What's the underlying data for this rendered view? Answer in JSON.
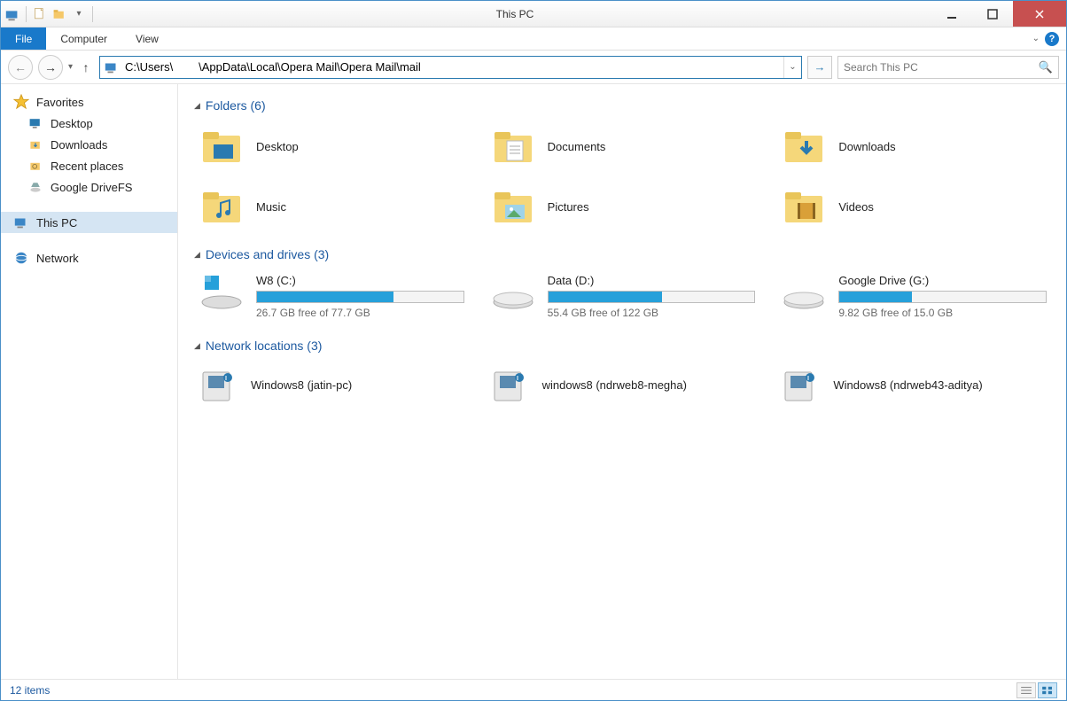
{
  "window": {
    "title": "This PC"
  },
  "ribbon": {
    "file": "File",
    "computer": "Computer",
    "view": "View"
  },
  "nav": {
    "address": "C:\\Users\\        \\AppData\\Local\\Opera Mail\\Opera Mail\\mail",
    "search_placeholder": "Search This PC"
  },
  "sidebar": {
    "favorites": {
      "label": "Favorites",
      "items": [
        "Desktop",
        "Downloads",
        "Recent places",
        "Google DriveFS"
      ]
    },
    "thispc": {
      "label": "This PC"
    },
    "network": {
      "label": "Network"
    }
  },
  "sections": {
    "folders": {
      "title": "Folders (6)",
      "items": [
        "Desktop",
        "Documents",
        "Downloads",
        "Music",
        "Pictures",
        "Videos"
      ]
    },
    "drives": {
      "title": "Devices and drives (3)",
      "items": [
        {
          "name": "W8 (C:)",
          "free": "26.7 GB free of 77.7 GB",
          "used_pct": 66
        },
        {
          "name": "Data (D:)",
          "free": "55.4 GB free of 122 GB",
          "used_pct": 55
        },
        {
          "name": "Google Drive (G:)",
          "free": "9.82 GB free of 15.0 GB",
          "used_pct": 35
        }
      ]
    },
    "netloc": {
      "title": "Network locations (3)",
      "items": [
        "Windows8 (jatin-pc)",
        "windows8 (ndrweb8-megha)",
        "Windows8 (ndrweb43-aditya)"
      ]
    }
  },
  "status": {
    "text": "12 items"
  }
}
